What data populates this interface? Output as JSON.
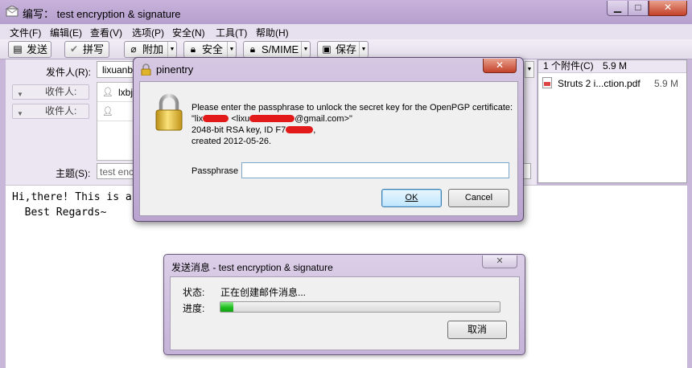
{
  "window": {
    "title": "编写： test encryption & signature",
    "min_glyph": "▁",
    "max_glyph": "□",
    "close_glyph": "✕"
  },
  "menu": [
    "文件(F)",
    "编辑(E)",
    "查看(V)",
    "选项(P)",
    "安全(N)",
    "工具(T)",
    "帮助(H)"
  ],
  "toolbar": {
    "send": "发送",
    "spell": "拼写",
    "attach": "附加",
    "security": "安全",
    "smime": "S/MIME",
    "save": "保存"
  },
  "compose": {
    "from_label": "发件人(R):",
    "from_value": "lixuanb",
    "to_label": "收件人:",
    "to_value": "lxbj",
    "to2_label": "收件人:",
    "subject_label": "主题(S):",
    "subject_value": "test enc",
    "body_line1": "Hi,there! This is a",
    "body_line2": "  Best Regards~"
  },
  "attachments": {
    "header": "1 个附件(C)",
    "total_size": "5.9 M",
    "items": [
      {
        "name": "Struts 2 i...ction.pdf",
        "size": "5.9 M"
      }
    ]
  },
  "pinentry": {
    "title": "pinentry",
    "close_glyph": "✕",
    "message_line1": "Please enter the passphrase to unlock the secret key for the OpenPGP certificate:",
    "message_line2_prefix": "\"lix",
    "message_line2_middle": " <lixu",
    "message_line2_suffix": "@gmail.com>\"",
    "message_line3": "2048-bit RSA key, ID F7",
    "message_line3_end": ",",
    "message_line4": "created 2012-05-26.",
    "passphrase_label": "Passphrase",
    "passphrase_value": "",
    "ok_label": "OK",
    "cancel_label": "Cancel"
  },
  "send_dialog": {
    "title": "发送消息 - test encryption & signature",
    "close_glyph": "✕",
    "status_label": "状态:",
    "status_value": "正在创建邮件消息...",
    "progress_label": "进度:",
    "progress": 0.045,
    "cancel_label": "取消"
  },
  "colors": {
    "redaction": "#e21a1a",
    "progress": "#1fbf1f",
    "title_bar": "#c8b3dc"
  }
}
